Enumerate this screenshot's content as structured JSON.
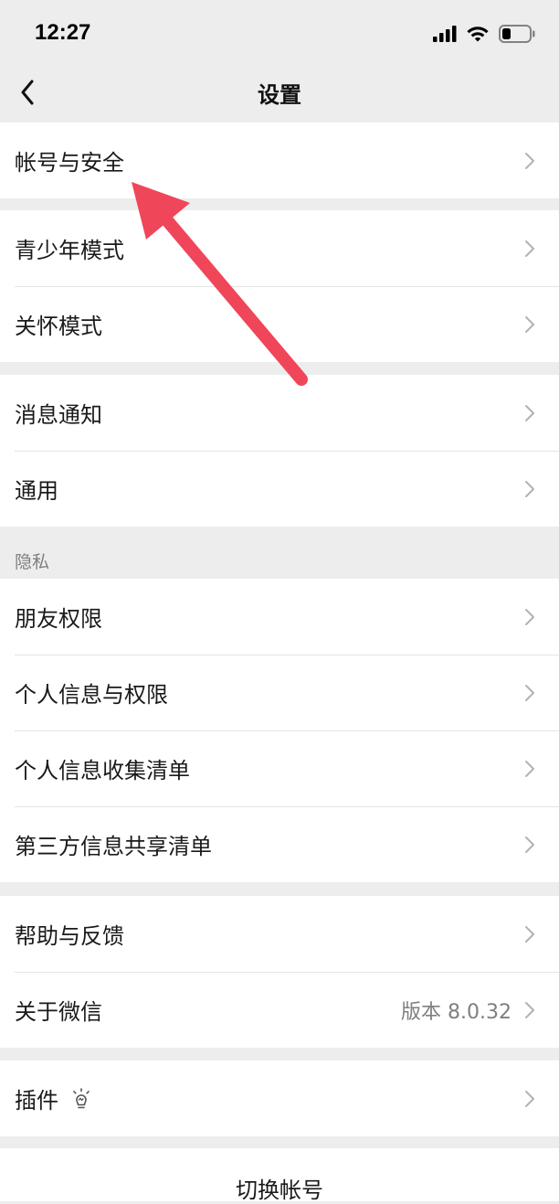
{
  "status_bar": {
    "time": "12:27"
  },
  "nav": {
    "title": "设置",
    "back_icon": "chevron-left-icon"
  },
  "groups": [
    {
      "items": [
        {
          "label": "帐号与安全"
        }
      ]
    },
    {
      "items": [
        {
          "label": "青少年模式"
        },
        {
          "label": "关怀模式"
        }
      ]
    },
    {
      "items": [
        {
          "label": "消息通知"
        },
        {
          "label": "通用"
        }
      ]
    },
    {
      "header": "隐私",
      "items": [
        {
          "label": "朋友权限"
        },
        {
          "label": "个人信息与权限"
        },
        {
          "label": "个人信息收集清单"
        },
        {
          "label": "第三方信息共享清单"
        }
      ]
    },
    {
      "items": [
        {
          "label": "帮助与反馈"
        },
        {
          "label": "关于微信",
          "value": "版本 8.0.32"
        }
      ]
    },
    {
      "items": [
        {
          "label": "插件",
          "icon": "lightbulb-icon"
        }
      ]
    }
  ],
  "footer": {
    "switch_account": "切换帐号"
  },
  "colors": {
    "background": "#ededed",
    "arrow": "#f0465a"
  }
}
